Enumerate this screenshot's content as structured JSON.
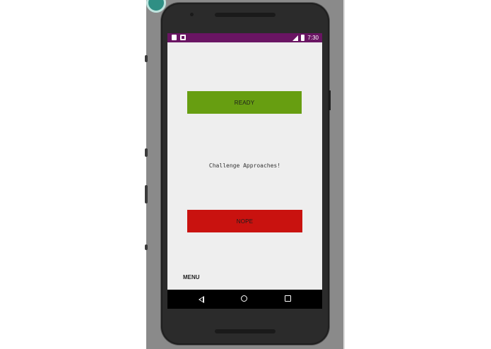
{
  "status_bar": {
    "time": "7:30",
    "color": "#6a1563",
    "icons": [
      "sd-card-icon",
      "notification-icon",
      "signal-icon",
      "battery-icon"
    ]
  },
  "main": {
    "ready_label": "READY",
    "ready_color": "#679e11",
    "challenge_text": "Challenge Approaches!",
    "nope_label": "NOPE",
    "nope_color": "#c9120f",
    "menu_label": "MENU"
  },
  "nav_bar": {
    "icons": [
      "back-icon",
      "home-icon",
      "recents-icon"
    ]
  }
}
